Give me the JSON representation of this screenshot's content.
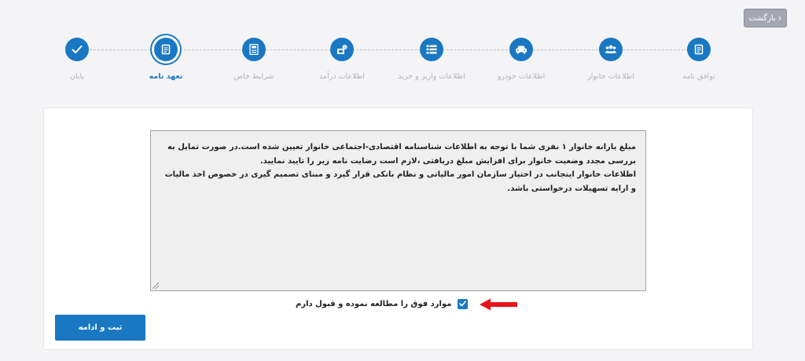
{
  "header": {
    "back_label": "بازگشت"
  },
  "steps": [
    {
      "label": "توافق نامه",
      "icon": "document-icon"
    },
    {
      "label": "اطلاعات خانوار",
      "icon": "users-icon"
    },
    {
      "label": "اطلاعات خودرو",
      "icon": "car-icon"
    },
    {
      "label": "اطلاعات واریز و خرید",
      "icon": "list-icon"
    },
    {
      "label": "اطلاعات درآمد",
      "icon": "money-icon"
    },
    {
      "label": "شرایط خاص",
      "icon": "calculator-icon"
    },
    {
      "label": "تعهد نامه",
      "icon": "document-icon",
      "active": true
    },
    {
      "label": "پایان",
      "icon": "check-icon"
    }
  ],
  "agreement": {
    "paragraph1": "مبلغ یارانه خانوار ۱ نفری شما با توجه به اطلاعات شناسنامه اقتصادی-اجتماعی خانوار تعیین شده است.در صورت تمایل به بررسی مجدد وضعیت خانوار برای افزایش مبلغ دریافتی ،لازم است رضایت نامه زیر را تایید نمایید.",
    "paragraph2": "اطلاعات خانوار اینجانب در اختیار سازمان امور مالیاتی و نظام بانکی قرار گیرد و مبنای تصمیم گیری در خصوص اخذ مالیات و ارایه تسهیلات درخواستی باشد."
  },
  "consent": {
    "label": "موارد فوق را مطالعه نموده و قبول دارم",
    "checked": true
  },
  "actions": {
    "submit_label": "ثبت و ادامه"
  },
  "colors": {
    "primary": "#1a78c2",
    "arrow": "#e5141a"
  }
}
